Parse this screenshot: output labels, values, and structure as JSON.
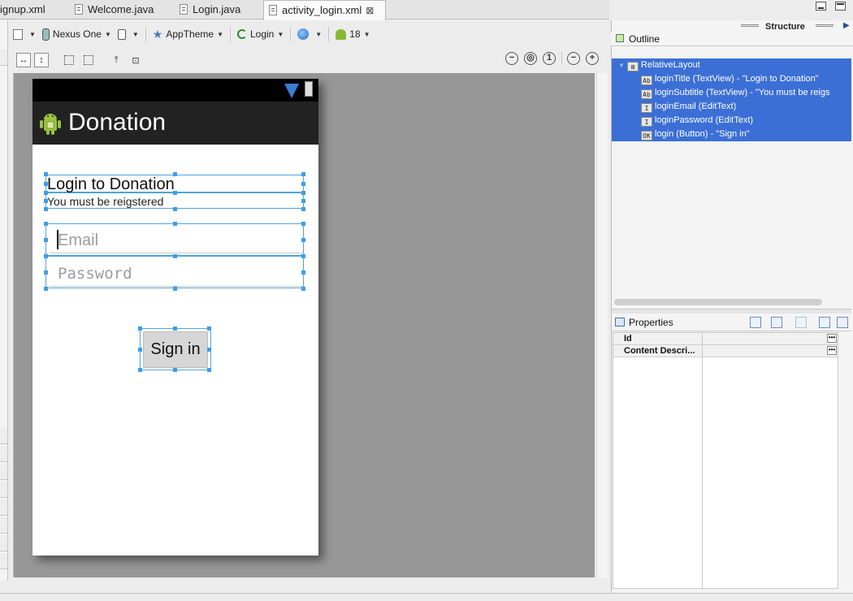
{
  "tabs": [
    {
      "label": "ignup.xml",
      "active": false
    },
    {
      "label": "Welcome.java",
      "active": false
    },
    {
      "label": "Login.java",
      "active": false
    },
    {
      "label": "activity_login.xml",
      "active": true
    }
  ],
  "toolbar": {
    "device": "Nexus One",
    "theme": "AppTheme",
    "activity": "Login",
    "api_level": "18"
  },
  "device_preview": {
    "app_title": "Donation",
    "login_title": "Login to Donation",
    "login_subtitle": "You must be reigstered",
    "email_placeholder": "Email",
    "password_placeholder": "Password",
    "signin_label": "Sign in"
  },
  "structure": {
    "title": "Structure",
    "outline_label": "Outline",
    "tree": [
      {
        "label": "RelativeLayout",
        "icon": "relative-layout-icon"
      },
      {
        "label": "loginTitle (TextView) - \"Login to Donation\"",
        "icon": "textview-icon",
        "badge": "Ab"
      },
      {
        "label": "loginSubtitle (TextView) - \"You must be reigs",
        "icon": "textview-icon",
        "badge": "Ab"
      },
      {
        "label": "loginEmail (EditText)",
        "icon": "edittext-icon",
        "badge": "I"
      },
      {
        "label": "loginPassword (EditText)",
        "icon": "edittext-icon",
        "badge": "I"
      },
      {
        "label": "login (Button) - \"Sign in\"",
        "icon": "button-icon",
        "badge": "OK"
      }
    ]
  },
  "properties": {
    "label": "Properties",
    "rows": [
      {
        "key": "Id"
      },
      {
        "key": "Content Descri..."
      }
    ]
  },
  "colors": {
    "selection": "#3b6fd6",
    "handle": "#3e9de8",
    "canvas": "#979797",
    "actionbar": "#222222"
  }
}
